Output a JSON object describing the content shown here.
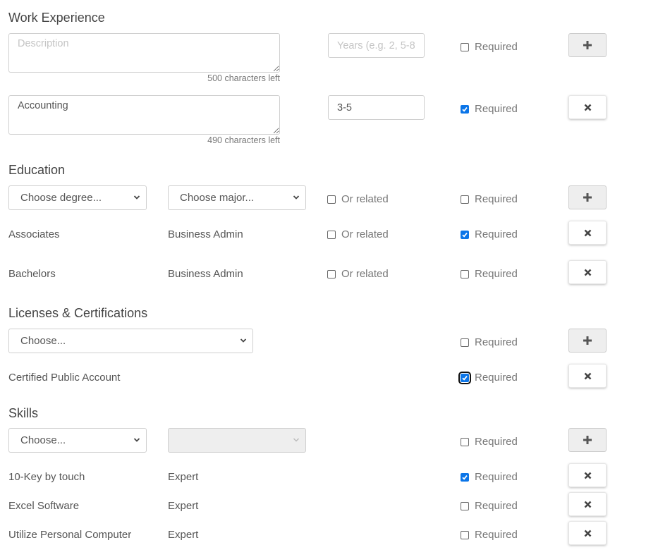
{
  "work_experience": {
    "title": "Work Experience",
    "new_entry": {
      "description_placeholder": "Description",
      "description_value": "",
      "counter": "500 characters left",
      "years_placeholder": "Years (e.g. 2, 5-8)",
      "years_value": "",
      "required_label": "Required",
      "required_checked": false,
      "action_icon": "plus-icon"
    },
    "entries": [
      {
        "description": "Accounting",
        "counter": "490 characters left",
        "years": "3-5",
        "required_label": "Required",
        "required_checked": true,
        "action_icon": "close-icon"
      }
    ]
  },
  "education": {
    "title": "Education",
    "new_entry": {
      "degree_select": "Choose degree...",
      "major_select": "Choose major...",
      "or_related_label": "Or related",
      "or_related_checked": false,
      "required_label": "Required",
      "required_checked": false,
      "action_icon": "plus-icon"
    },
    "entries": [
      {
        "degree": "Associates",
        "major": "Business Admin",
        "or_related_label": "Or related",
        "or_related_checked": false,
        "required_label": "Required",
        "required_checked": true,
        "action_icon": "close-icon"
      },
      {
        "degree": "Bachelors",
        "major": "Business Admin",
        "or_related_label": "Or related",
        "or_related_checked": false,
        "required_label": "Required",
        "required_checked": false,
        "action_icon": "close-icon"
      }
    ]
  },
  "licenses": {
    "title": "Licenses & Certifications",
    "new_entry": {
      "select": "Choose...",
      "required_label": "Required",
      "required_checked": false,
      "action_icon": "plus-icon"
    },
    "entries": [
      {
        "name": "Certified Public Account",
        "required_label": "Required",
        "required_checked": true,
        "focused": true,
        "action_icon": "close-icon"
      }
    ]
  },
  "skills": {
    "title": "Skills",
    "new_entry": {
      "skill_select": "Choose...",
      "level_select": "",
      "level_disabled": true,
      "required_label": "Required",
      "required_checked": false,
      "action_icon": "plus-icon"
    },
    "entries": [
      {
        "name": "10-Key by touch",
        "level": "Expert",
        "required_label": "Required",
        "required_checked": true,
        "action_icon": "close-icon"
      },
      {
        "name": "Excel Software",
        "level": "Expert",
        "required_label": "Required",
        "required_checked": false,
        "action_icon": "close-icon"
      },
      {
        "name": "Utilize Personal Computer",
        "level": "Expert",
        "required_label": "Required",
        "required_checked": false,
        "action_icon": "close-icon"
      }
    ]
  },
  "colors": {
    "checkbox_checked": "#0b75e8",
    "add_button_bg": "#eeeeee",
    "text": "#555555"
  }
}
